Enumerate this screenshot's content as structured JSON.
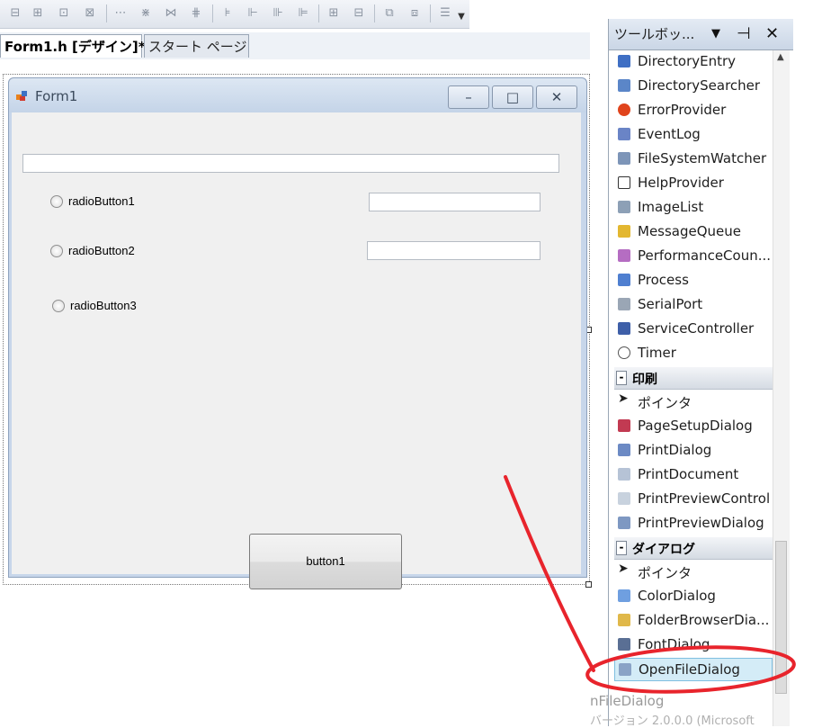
{
  "toolbar": {
    "icons": [
      "align-lefts-icon",
      "align-centers-icon",
      "align-rights-icon",
      "align-tops-icon",
      "align-middles-icon",
      "align-bottoms-icon",
      "make-same-size-icon",
      "size-to-grid-icon",
      "horizontal-spacing-icon",
      "vertical-spacing-icon",
      "center-horizontally-icon",
      "center-vertically-icon",
      "bring-to-front-icon",
      "send-to-back-icon",
      "tab-order-icon"
    ]
  },
  "tabs": {
    "design": "Form1.h [デザイン]*",
    "start": "スタート ページ"
  },
  "form": {
    "title": "Form1",
    "minimize": "–",
    "maximize": "□",
    "close": "✕",
    "radio1": "radioButton1",
    "radio2": "radioButton2",
    "radio3": "radioButton3",
    "button1": "button1"
  },
  "toolbox": {
    "title": "ツールボッ...",
    "items": [
      "DirectoryEntry",
      "DirectorySearcher",
      "ErrorProvider",
      "EventLog",
      "FileSystemWatcher",
      "HelpProvider",
      "ImageList",
      "MessageQueue",
      "PerformanceCoun...",
      "Process",
      "SerialPort",
      "ServiceController",
      "Timer"
    ],
    "group_print": "印刷",
    "print_items": [
      "ポインタ",
      "PageSetupDialog",
      "PrintDialog",
      "PrintDocument",
      "PrintPreviewControl",
      "PrintPreviewDialog"
    ],
    "group_dialog": "ダイアログ",
    "dialog_items": [
      "ポインタ",
      "ColorDialog",
      "FolderBrowserDia...",
      "FontDialog",
      "OpenFileDialog"
    ]
  },
  "ghost": {
    "line1": "nFileDialog",
    "line2": "バージョン 2.0.0.0 (Microsoft"
  },
  "colors": {
    "annotation": "#e8242c",
    "selected_item": "#d4ecf7"
  }
}
